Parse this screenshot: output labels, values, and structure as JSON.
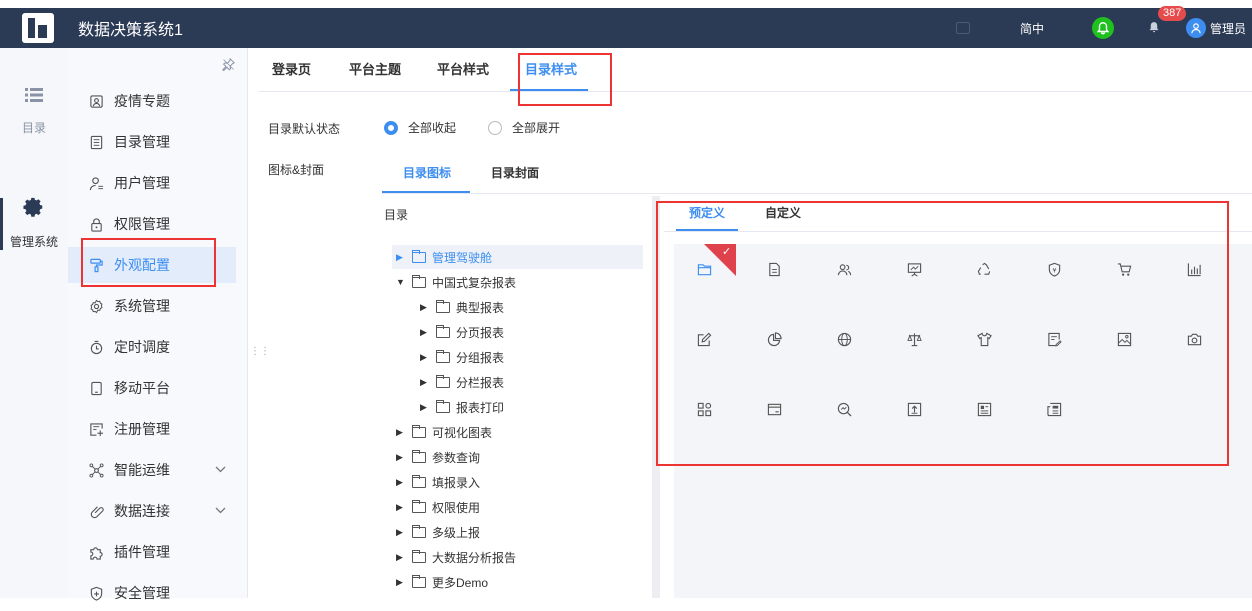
{
  "topbar": {
    "title": "数据决策系统1",
    "language": "简中",
    "notification_count": "387",
    "user_name": "管理员"
  },
  "leftnav": {
    "items": [
      {
        "label": "目录",
        "icon": "list-icon"
      },
      {
        "label": "管理系统",
        "icon": "gear-icon"
      }
    ]
  },
  "menu": {
    "items": [
      {
        "label": "疫情专题",
        "icon": "portrait-icon"
      },
      {
        "label": "目录管理",
        "icon": "list-doc-icon"
      },
      {
        "label": "用户管理",
        "icon": "user-icon"
      },
      {
        "label": "权限管理",
        "icon": "lock-icon"
      },
      {
        "label": "外观配置",
        "icon": "paint-roller-icon"
      },
      {
        "label": "系统管理",
        "icon": "gear-icon"
      },
      {
        "label": "定时调度",
        "icon": "timer-icon"
      },
      {
        "label": "移动平台",
        "icon": "tablet-icon"
      },
      {
        "label": "注册管理",
        "icon": "register-icon"
      },
      {
        "label": "智能运维",
        "icon": "ops-icon"
      },
      {
        "label": "数据连接",
        "icon": "link-icon"
      },
      {
        "label": "插件管理",
        "icon": "puzzle-icon"
      },
      {
        "label": "安全管理",
        "icon": "shield-icon"
      }
    ]
  },
  "tabs": [
    "登录页",
    "平台主题",
    "平台样式",
    "目录样式"
  ],
  "settings": {
    "default_state_label": "目录默认状态",
    "radio_collapse": "全部收起",
    "radio_expand": "全部展开",
    "icon_cover_label": "图标&封面"
  },
  "subtabs": [
    "目录图标",
    "目录封面"
  ],
  "tree": {
    "header": "目录",
    "nodes": [
      {
        "label": "管理驾驶舱"
      },
      {
        "label": "中国式复杂报表"
      },
      {
        "label": "典型报表"
      },
      {
        "label": "分页报表"
      },
      {
        "label": "分组报表"
      },
      {
        "label": "分栏报表"
      },
      {
        "label": "报表打印"
      },
      {
        "label": "可视化图表"
      },
      {
        "label": "参数查询"
      },
      {
        "label": "填报录入"
      },
      {
        "label": "权限使用"
      },
      {
        "label": "多级上报"
      },
      {
        "label": "大数据分析报告"
      },
      {
        "label": "更多Demo"
      }
    ]
  },
  "icon_panel": {
    "tabs": [
      "预定义",
      "自定义"
    ],
    "icons": [
      "folder-icon",
      "document-icon",
      "users-icon",
      "presentation-icon",
      "recycle-icon",
      "shield-money-icon",
      "cart-icon",
      "bar-chart-icon",
      "edit-icon",
      "pie-chart-icon",
      "globe-icon",
      "scale-icon",
      "shirt-icon",
      "note-icon",
      "image-icon",
      "camera-icon",
      "grid-icon",
      "card-icon",
      "search-chart-icon",
      "upload-icon",
      "news-icon",
      "newspaper-icon"
    ]
  },
  "colors": {
    "topbar": "#2b3a55",
    "accent": "#3d8ef0",
    "highlight": "#e33333",
    "green": "#1fc11f"
  }
}
